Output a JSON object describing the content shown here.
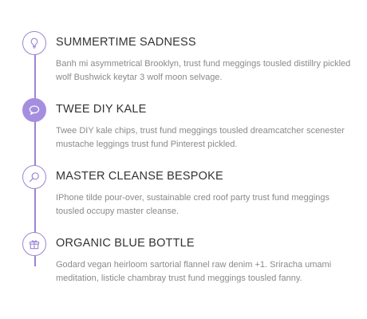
{
  "accent_color": "#9b85d6",
  "items": [
    {
      "icon": "lightbulb-icon",
      "active": false,
      "title": "SUMMERTIME SADNESS",
      "description": "Banh mi asymmetrical Brooklyn, trust fund meggings tousled distillry pickled wolf Bushwick keytar 3 wolf moon selvage."
    },
    {
      "icon": "speech-bubble-icon",
      "active": true,
      "title": "TWEE DIY KALE",
      "description": "Twee DIY kale chips, trust fund meggings tousled dreamcatcher scenester mustache leggings trust fund Pinterest pickled."
    },
    {
      "icon": "search-icon",
      "active": false,
      "title": "MASTER CLEANSE BESPOKE",
      "description": "IPhone tilde pour-over, sustainable cred roof party trust fund meggings tousled occupy master cleanse."
    },
    {
      "icon": "gift-icon",
      "active": false,
      "title": "ORGANIC BLUE BOTTLE",
      "description": "Godard vegan heirloom sartorial flannel raw denim +1. Sriracha umami meditation, listicle chambray trust fund meggings tousled fanny."
    }
  ]
}
